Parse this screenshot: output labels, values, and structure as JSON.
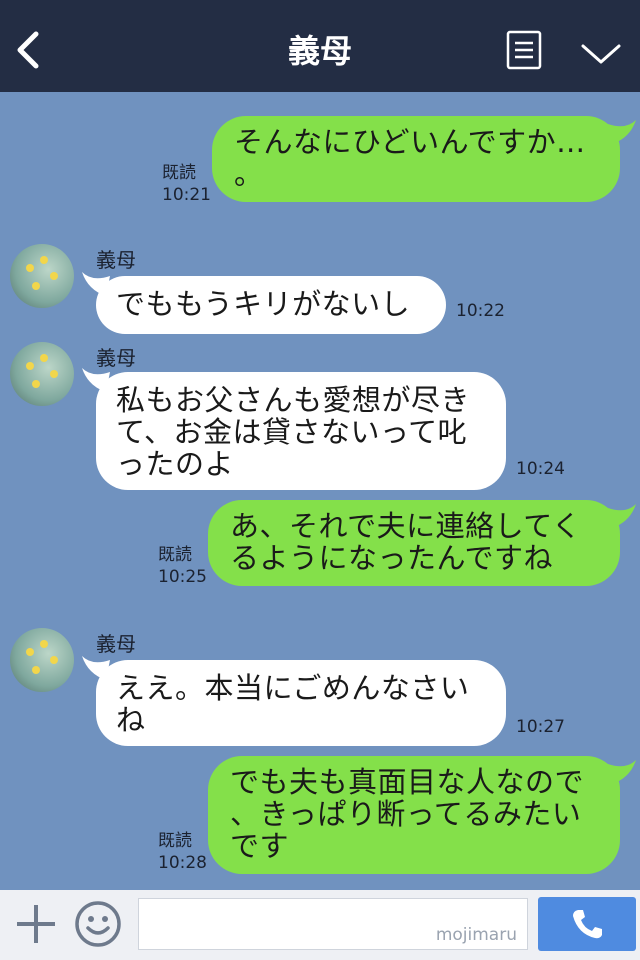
{
  "header": {
    "title": "義母"
  },
  "messages": [
    {
      "dir": "out",
      "text_lines": [
        "そんなにひどいんですか…",
        "。"
      ],
      "read": "既読",
      "time": "10:21"
    },
    {
      "dir": "in",
      "sender": "義母",
      "text_lines": [
        "でももうキリがないし"
      ],
      "time": "10:22"
    },
    {
      "dir": "in",
      "sender": "義母",
      "text_lines": [
        "私もお父さんも愛想が尽き",
        "て、お金は貸さないって叱",
        "ったのよ"
      ],
      "time": "10:24"
    },
    {
      "dir": "out",
      "text_lines": [
        "あ、それで夫に連絡してく",
        "るようになったんですね"
      ],
      "read": "既読",
      "time": "10:25"
    },
    {
      "dir": "in",
      "sender": "義母",
      "text_lines": [
        "ええ。本当にごめんなさい",
        "ね"
      ],
      "time": "10:27"
    },
    {
      "dir": "out",
      "text_lines": [
        "でも夫も真面目な人なので",
        "、きっぱり断ってるみたい",
        "です"
      ],
      "read": "既読",
      "time": "10:28"
    }
  ],
  "input": {
    "watermark": "mojimaru",
    "value": ""
  },
  "colors": {
    "header": "#232d44",
    "background": "#7092bf",
    "out_bubble": "#84e04a",
    "in_bubble": "#ffffff",
    "call_button": "#4f8be0"
  },
  "icons": [
    "back-chevron-icon",
    "menu-list-icon",
    "dropdown-chevron-icon",
    "plus-icon",
    "smiley-icon",
    "phone-icon"
  ]
}
